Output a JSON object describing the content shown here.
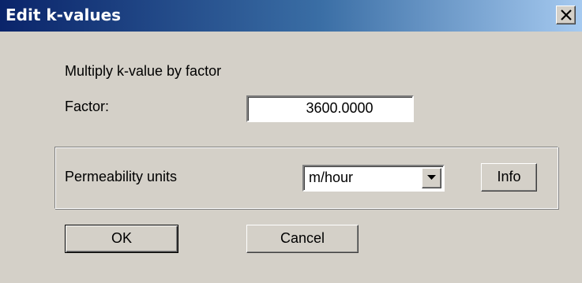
{
  "window": {
    "title": "Edit k-values",
    "close_icon": "close-icon"
  },
  "main": {
    "description": "Multiply k-value by factor",
    "factor_label": "Factor:",
    "factor_value": "3600.0000"
  },
  "permeability": {
    "label": "Permeability units",
    "selected_unit": "m/hour",
    "info_button": "Info"
  },
  "buttons": {
    "ok": "OK",
    "cancel": "Cancel"
  },
  "colors": {
    "titlebar_start": "#0a246a",
    "titlebar_end": "#a6caf0",
    "dialog_bg": "#d4d0c8"
  }
}
